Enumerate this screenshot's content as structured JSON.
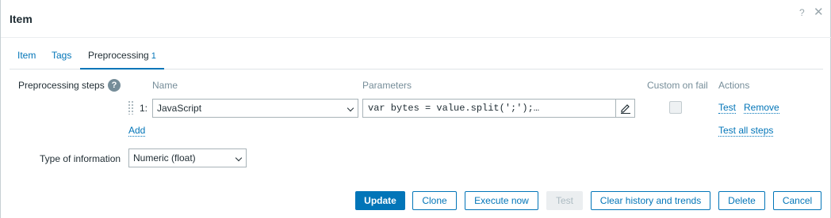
{
  "dialog": {
    "title": "Item",
    "help_icon": "?",
    "close_icon": "✕"
  },
  "tabs": [
    {
      "label": "Item"
    },
    {
      "label": "Tags"
    },
    {
      "label": "Preprocessing",
      "count": "1"
    }
  ],
  "preprocessing": {
    "label": "Preprocessing steps",
    "help_icon": "?",
    "columns": {
      "name": "Name",
      "parameters": "Parameters",
      "custom_on_fail": "Custom on fail",
      "actions": "Actions"
    },
    "steps": [
      {
        "number": "1:",
        "name": "JavaScript",
        "parameters": "var bytes = value.split(';');…",
        "custom_on_fail": false,
        "test_label": "Test",
        "remove_label": "Remove"
      }
    ],
    "add_label": "Add",
    "test_all_label": "Test all steps"
  },
  "type_of_information": {
    "label": "Type of information",
    "value": "Numeric (float)"
  },
  "footer": {
    "update": "Update",
    "clone": "Clone",
    "execute_now": "Execute now",
    "test": "Test",
    "clear_history": "Clear history and trends",
    "delete": "Delete",
    "cancel": "Cancel"
  }
}
